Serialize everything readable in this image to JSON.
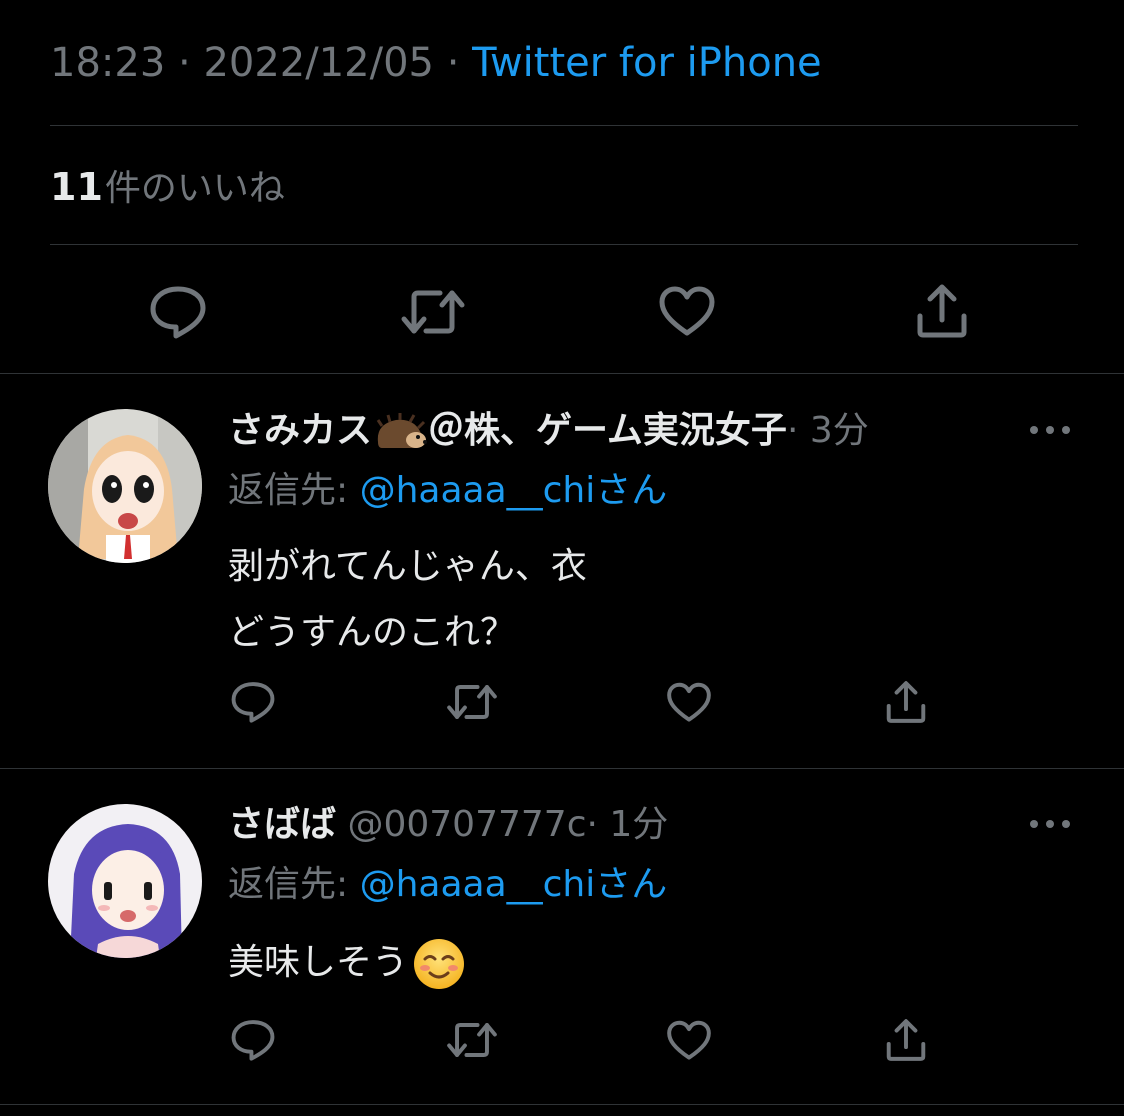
{
  "tweet": {
    "time": "18:23",
    "date": "2022/12/05",
    "separator": " · ",
    "source": "Twitter for iPhone",
    "likes_count": "11",
    "likes_label": "件のいいね"
  },
  "actions": {
    "reply_icon": "reply-bubble-icon",
    "retweet_icon": "retweet-icon",
    "like_icon": "heart-icon",
    "share_icon": "share-upload-icon"
  },
  "replies": [
    {
      "name": "さみカス🦔＠株、ゲーム実況女子",
      "name_text": "さみカス",
      "name_emoji": "hedgehog-icon",
      "name_suffix": "＠株、ゲーム実況女子",
      "time": "· 3分",
      "reply_to_label": "返信先: ",
      "reply_to_handle": "@haaaa__chi",
      "reply_to_suffix": "さん",
      "text_line1": "剥がれてんじゃん、衣",
      "text_line2": "どうすんのこれ？",
      "more_icon": "more-dots-icon"
    },
    {
      "name": "さばば",
      "handle": "@00707777c",
      "time": "· 1分",
      "reply_to_label": "返信先: ",
      "reply_to_handle": "@haaaa__chi",
      "reply_to_suffix": "さん",
      "text_line1": "美味しそう",
      "text_emoji": "smiling-face-icon",
      "more_icon": "more-dots-icon"
    }
  ],
  "colors": {
    "background": "#000000",
    "text": "#e7e9ea",
    "secondary": "#71767b",
    "accent": "#1d9bf0",
    "divider": "#2f3336"
  }
}
